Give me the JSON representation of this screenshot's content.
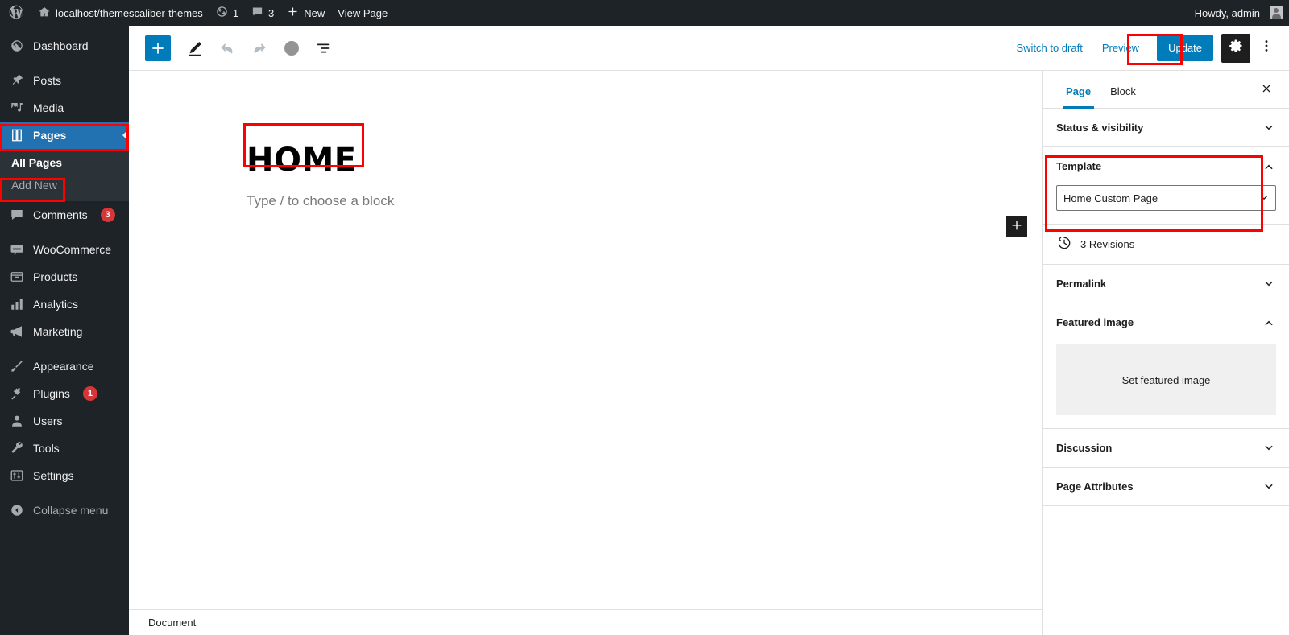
{
  "adminbar": {
    "logo_icon": "wordpress-logo-icon",
    "site_icon": "home-icon",
    "site_name": "localhost/themescaliber-themes",
    "updates_icon": "updates-icon",
    "updates_count": "1",
    "comments_icon": "comment-bubble-icon",
    "comments_count": "3",
    "new_icon": "plus-icon",
    "new_label": "New",
    "view_page_label": "View Page",
    "howdy": "Howdy, admin",
    "avatar_icon": "user-avatar-icon"
  },
  "adminmenu": {
    "items": [
      {
        "label": "Dashboard",
        "icon": "dashboard-icon",
        "current": false,
        "badge": ""
      },
      {
        "label": "Posts",
        "icon": "pin-icon",
        "current": false,
        "badge": ""
      },
      {
        "label": "Media",
        "icon": "media-icon",
        "current": false,
        "badge": ""
      },
      {
        "label": "Pages",
        "icon": "pages-icon",
        "current": true,
        "badge": ""
      },
      {
        "label": "Comments",
        "icon": "comment-bubble-icon",
        "current": false,
        "badge": "3"
      },
      {
        "label": "WooCommerce",
        "icon": "woocommerce-icon",
        "current": false,
        "badge": ""
      },
      {
        "label": "Products",
        "icon": "products-icon",
        "current": false,
        "badge": ""
      },
      {
        "label": "Analytics",
        "icon": "analytics-bars-icon",
        "current": false,
        "badge": ""
      },
      {
        "label": "Marketing",
        "icon": "megaphone-icon",
        "current": false,
        "badge": ""
      },
      {
        "label": "Appearance",
        "icon": "paintbrush-icon",
        "current": false,
        "badge": ""
      },
      {
        "label": "Plugins",
        "icon": "plug-icon",
        "current": false,
        "badge": "1"
      },
      {
        "label": "Users",
        "icon": "user-icon",
        "current": false,
        "badge": ""
      },
      {
        "label": "Tools",
        "icon": "wrench-icon",
        "current": false,
        "badge": ""
      },
      {
        "label": "Settings",
        "icon": "sliders-icon",
        "current": false,
        "badge": ""
      }
    ],
    "submenu": [
      {
        "label": "All Pages",
        "current": true
      },
      {
        "label": "Add New",
        "current": false
      }
    ],
    "collapse_label": "Collapse menu",
    "collapse_icon": "collapse-arrow-icon"
  },
  "toolbar": {
    "add_block_icon": "plus-icon",
    "tools_icon": "pencil-icon",
    "undo_icon": "undo-arrow-icon",
    "redo_icon": "redo-arrow-icon",
    "details_icon": "info-circle-icon",
    "list_view_icon": "list-view-icon",
    "switch_to_draft_label": "Switch to draft",
    "preview_label": "Preview",
    "update_label": "Update",
    "settings_icon": "gear-icon",
    "options_icon": "kebab-menu-icon"
  },
  "canvas": {
    "post_title": "HOME",
    "block_placeholder": "Type / to choose a block",
    "appender_icon": "plus-icon",
    "breadcrumb": "Document"
  },
  "sidebar": {
    "tabs": [
      {
        "label": "Page",
        "active": true
      },
      {
        "label": "Block",
        "active": false
      }
    ],
    "close_icon": "close-icon",
    "panels": [
      {
        "title": "Status & visibility",
        "state": "collapsed",
        "chevron": "chevron-down-icon"
      },
      {
        "title": "Template",
        "state": "expanded",
        "chevron": "chevron-up-icon"
      },
      {
        "title": "Permalink",
        "state": "collapsed",
        "chevron": "chevron-down-icon"
      },
      {
        "title": "Featured image",
        "state": "expanded",
        "chevron": "chevron-up-icon"
      },
      {
        "title": "Discussion",
        "state": "collapsed",
        "chevron": "chevron-down-icon"
      },
      {
        "title": "Page Attributes",
        "state": "collapsed",
        "chevron": "chevron-down-icon"
      }
    ],
    "template": {
      "selected": "Home Custom Page",
      "options": [
        "Home Custom Page"
      ],
      "chevron": "chevron-down-icon"
    },
    "revisions": {
      "label": "3 Revisions",
      "icon": "revision-clock-icon"
    },
    "featured_image": {
      "button_label": "Set featured image"
    }
  },
  "colors": {
    "wp_admin_bg": "#1d2327",
    "wp_submenu_bg": "#2c3338",
    "wp_current_blue": "#2271b1",
    "accent_blue": "#007cba",
    "badge_red": "#d63638",
    "annotation_red": "#ff0000"
  },
  "annotations": [
    {
      "target": "sidebar-item-pages"
    },
    {
      "target": "submenu-item-add-new"
    },
    {
      "target": "post-title"
    },
    {
      "target": "update-button"
    },
    {
      "target": "template-panel"
    }
  ]
}
